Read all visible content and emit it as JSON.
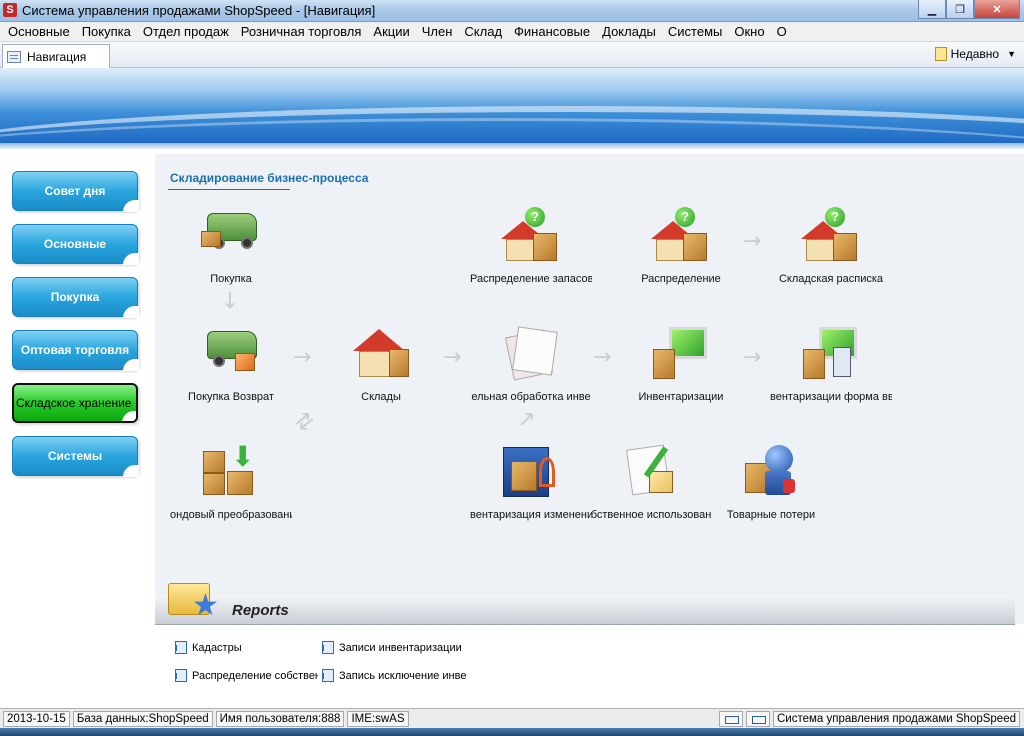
{
  "window": {
    "title": "Система управления продажами ShopSpeed - [Навигация]",
    "logo_letter": "S"
  },
  "menu": [
    "Основные",
    "Покупка",
    "Отдел продаж",
    "Розничная торговля",
    "Акции",
    "Член",
    "Склад",
    "Финансовые",
    "Доклады",
    "Системы",
    "Окно",
    "О"
  ],
  "tab": {
    "label": "Навигация"
  },
  "recent": {
    "label": "Недавно"
  },
  "sidebar": {
    "items": [
      {
        "label": "Совет дня"
      },
      {
        "label": "Основные"
      },
      {
        "label": "Покупка"
      },
      {
        "label": "Оптовая торговля"
      },
      {
        "label": "Складское хранение"
      },
      {
        "label": "Системы"
      }
    ],
    "active_index": 4
  },
  "process": {
    "title": "Складирование бизнес-процесса",
    "nodes": {
      "purchase": "Покупка",
      "stock_distribution": "Распределение запасов",
      "distribution": "Распределение",
      "warehouse_receipt": "Складская расписка",
      "purchase_return": "Покупка Возврат",
      "warehouses": "Склады",
      "inventory_processing": "ельная обработка инве",
      "inventory": "Инвентаризации",
      "inventory_form": "вентаризации форма вво",
      "fund_transform": "ондовый преобразовани",
      "inventory_change": "вентаризация изменени",
      "own_use": "бственное использован",
      "goods_loss": "Товарные потери"
    }
  },
  "reports": {
    "title": "Reports",
    "links": [
      "Кадастры",
      "Записи инвентаризации",
      "Распределение собствен",
      "Запись исключение инве"
    ]
  },
  "status": {
    "date": "2013-10-15",
    "database": "База данных:ShopSpeed",
    "user": "Имя пользователя:888",
    "ime": "IME:swAS",
    "app": "Система управления продажами ShopSpeed"
  }
}
